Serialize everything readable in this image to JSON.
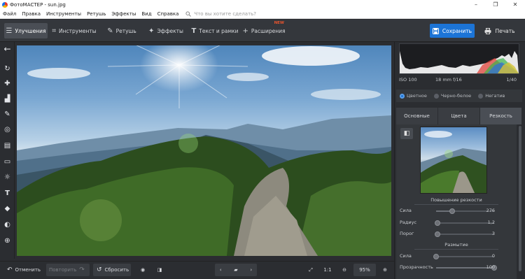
{
  "window": {
    "title": "ФотоМАСТЕР - sun.jpg",
    "controls": [
      "–",
      "❐",
      "✕"
    ]
  },
  "menu": {
    "items": [
      "Файл",
      "Правка",
      "Инструменты",
      "Ретушь",
      "Эффекты",
      "Вид",
      "Справка"
    ],
    "search_placeholder": "Что вы хотите сделать?"
  },
  "toolbar": {
    "tabs": [
      {
        "label": "Улучшения",
        "icon": "sliders-icon",
        "active": true
      },
      {
        "label": "Инструменты",
        "icon": "crop-icon",
        "active": false
      },
      {
        "label": "Ретушь",
        "icon": "brush-icon",
        "active": false
      },
      {
        "label": "Эффекты",
        "icon": "magic-wand-icon",
        "active": false
      },
      {
        "label": "Текст и рамки",
        "icon": "text-icon",
        "active": false
      },
      {
        "label": "Расширения",
        "icon": "plus-icon",
        "active": false,
        "badge": "NEW"
      }
    ],
    "save_label": "Сохранить",
    "print_label": "Печать"
  },
  "histogram_info": {
    "iso": "ISO 100",
    "lens": "18 mm f/16",
    "shutter": "1/40"
  },
  "color_modes": {
    "options": [
      "Цветное",
      "Черно-белое",
      "Негатив"
    ],
    "selected": "Цветное"
  },
  "panel_tabs": {
    "tabs": [
      "Основные",
      "Цвета",
      "Резкость"
    ],
    "active": "Резкость"
  },
  "sharpen": {
    "title": "Повышение резкости",
    "sliders": [
      {
        "label": "Сила",
        "value": "276",
        "fraction": 0.28
      },
      {
        "label": "Радиус",
        "value": "1,2",
        "fraction": 0.02
      },
      {
        "label": "Порог",
        "value": "3",
        "fraction": 0.02
      }
    ]
  },
  "blur": {
    "title": "Размытие",
    "sliders": [
      {
        "label": "Сила",
        "value": "0",
        "fraction": 0.0
      },
      {
        "label": "Прозрачность",
        "value": "100",
        "fraction": 1.0
      }
    ]
  },
  "bottom": {
    "undo_label": "Отменить",
    "redo_label": "Повторить",
    "reset_label": "Сбросить",
    "ratio_label": "1:1",
    "zoom_value": "95%"
  },
  "colors": {
    "accent": "#1c74d6",
    "new_badge": "#e7542e"
  }
}
